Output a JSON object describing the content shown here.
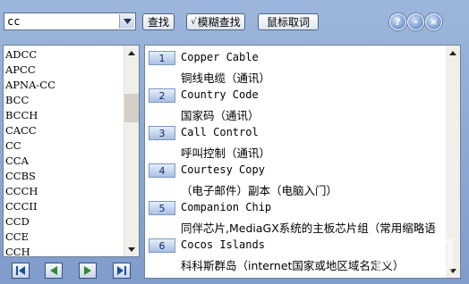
{
  "search": {
    "value": "cc"
  },
  "toolbar": {
    "find_label": "查找",
    "fuzzy_find_label": "模糊查找",
    "fuzzy_check": "√",
    "mouse_pick_label": "鼠标取词"
  },
  "window_buttons": {
    "help": "?",
    "minimize": "-",
    "close": "×"
  },
  "word_list": [
    "ADCC",
    "APCC",
    "APNA-CC",
    "BCC",
    "BCCH",
    "CACC",
    "CC",
    "CCA",
    "CCBS",
    "CCCH",
    "CCCII",
    "CCD",
    "CCE",
    "CCH"
  ],
  "results": [
    {
      "num": "1",
      "en": "Copper Cable",
      "zh": "铜线电缆（通讯）"
    },
    {
      "num": "2",
      "en": "Country Code",
      "zh": "国家码（通讯）"
    },
    {
      "num": "3",
      "en": "Call Control",
      "zh": "呼叫控制（通讯）"
    },
    {
      "num": "4",
      "en": "Courtesy Copy",
      "zh": "（电子邮件）副本（电脑入门）"
    },
    {
      "num": "5",
      "en": "Companion Chip",
      "zh": "同伴芯片,MediaGX系统的主板芯片组（常用缩略语"
    },
    {
      "num": "6",
      "en": "Cocos Islands",
      "zh": "科科斯群岛（internet国家或地区域名定义）"
    }
  ],
  "colors": {
    "accent": "#0d2f6e",
    "nav_green": "#2e8b2e",
    "nav_blue": "#1a4fa0",
    "window_bg": "#8aa6d2"
  }
}
